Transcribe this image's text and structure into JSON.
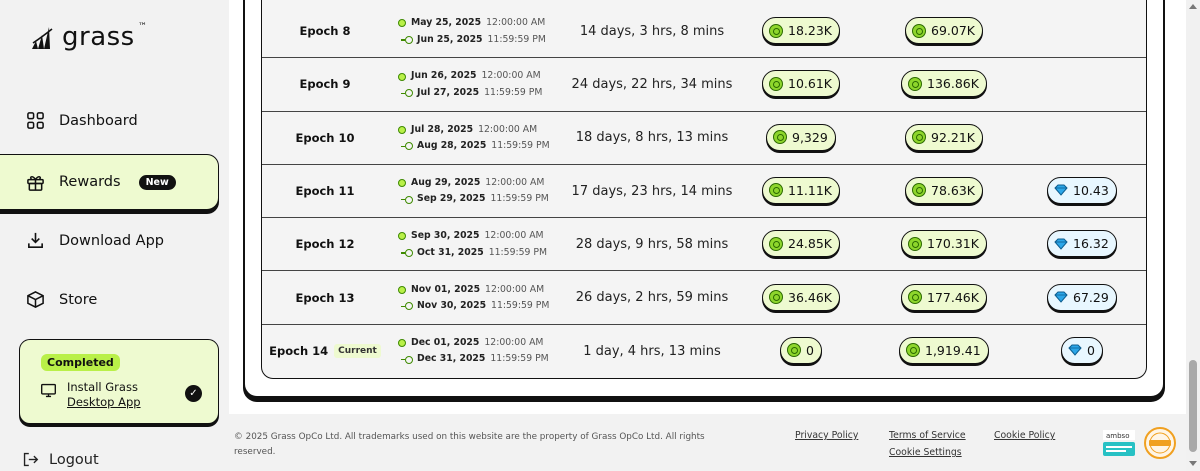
{
  "brand": {
    "name": "grass",
    "tm": "™"
  },
  "sidebar": {
    "items": [
      {
        "label": "Dashboard"
      },
      {
        "label": "Rewards",
        "badge": "New"
      },
      {
        "label": "Download App"
      },
      {
        "label": "Store"
      }
    ],
    "completed": {
      "tag": "Completed",
      "line1": "Install Grass",
      "line2": "Desktop App"
    },
    "logout": "Logout"
  },
  "epochs": [
    {
      "name": "Epoch 8",
      "start_date": "May 25, 2025",
      "start_time": "12:00:00 AM",
      "end_date": "Jun 25, 2025",
      "end_time": "11:59:59 PM",
      "duration": "14 days, 3 hrs, 8 mins",
      "points": "18.23K",
      "rewards": "69.07K",
      "bonus": ""
    },
    {
      "name": "Epoch 9",
      "start_date": "Jun 26, 2025",
      "start_time": "12:00:00 AM",
      "end_date": "Jul 27, 2025",
      "end_time": "11:59:59 PM",
      "duration": "24 days, 22 hrs, 34 mins",
      "points": "10.61K",
      "rewards": "136.86K",
      "bonus": ""
    },
    {
      "name": "Epoch 10",
      "start_date": "Jul 28, 2025",
      "start_time": "12:00:00 AM",
      "end_date": "Aug 28, 2025",
      "end_time": "11:59:59 PM",
      "duration": "18 days, 8 hrs, 13 mins",
      "points": "9,329",
      "rewards": "92.21K",
      "bonus": ""
    },
    {
      "name": "Epoch 11",
      "start_date": "Aug 29, 2025",
      "start_time": "12:00:00 AM",
      "end_date": "Sep 29, 2025",
      "end_time": "11:59:59 PM",
      "duration": "17 days, 23 hrs, 14 mins",
      "points": "11.11K",
      "rewards": "78.63K",
      "bonus": "10.43"
    },
    {
      "name": "Epoch 12",
      "start_date": "Sep 30, 2025",
      "start_time": "12:00:00 AM",
      "end_date": "Oct 31, 2025",
      "end_time": "11:59:59 PM",
      "duration": "28 days, 9 hrs, 58 mins",
      "points": "24.85K",
      "rewards": "170.31K",
      "bonus": "16.32"
    },
    {
      "name": "Epoch 13",
      "start_date": "Nov 01, 2025",
      "start_time": "12:00:00 AM",
      "end_date": "Nov 30, 2025",
      "end_time": "11:59:59 PM",
      "duration": "26 days, 2 hrs, 59 mins",
      "points": "36.46K",
      "rewards": "177.46K",
      "bonus": "67.29"
    },
    {
      "name": "Epoch 14",
      "current": "Current",
      "start_date": "Dec 01, 2025",
      "start_time": "12:00:00 AM",
      "end_date": "Dec 31, 2025",
      "end_time": "11:59:59 PM",
      "duration": "1 day, 4 hrs, 13 mins",
      "points": "0",
      "rewards": "1,919.41",
      "bonus": "0"
    }
  ],
  "footer": {
    "copyright": "© 2025 Grass OpCo Ltd. All trademarks used on this website are the property of Grass OpCo Ltd. All rights reserved.",
    "privacy": "Privacy Policy",
    "terms": "Terms of Service",
    "cookie_policy": "Cookie Policy",
    "cookie_settings": "Cookie Settings"
  }
}
